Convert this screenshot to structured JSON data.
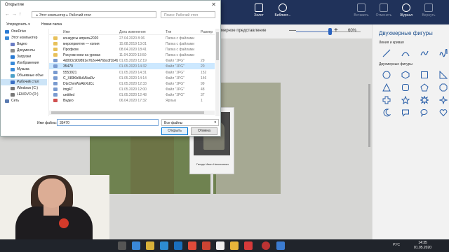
{
  "dialog": {
    "title": "Открытие",
    "close_glyph": "✕",
    "address": "▸ Этот компьютер ▸ Рабочий стол",
    "search_placeholder": "Поиск: Рабочий стол",
    "toolbar": {
      "organize": "Упорядочить ▾",
      "new_folder": "Новая папка"
    },
    "tree": [
      {
        "label": "OneDrive",
        "color": "#2b7bd3"
      },
      {
        "label": "Этот компьютер",
        "color": "#3a8ad8"
      },
      {
        "label": "Видео",
        "color": "#6a7cc4"
      },
      {
        "label": "Документы",
        "color": "#8d8d8d"
      },
      {
        "label": "Загрузки",
        "color": "#2b7bd3"
      },
      {
        "label": "Изображения",
        "color": "#3a8ad8"
      },
      {
        "label": "Музыка",
        "color": "#3a8ad8"
      },
      {
        "label": "Объемные объе",
        "color": "#4aa0c8"
      },
      {
        "label": "Рабочий стол",
        "color": "#3a6fc4",
        "selected": true
      },
      {
        "label": "Windows (C:)",
        "color": "#777777"
      },
      {
        "label": "LENOVO (D:)",
        "color": "#777777"
      },
      {
        "label": "Сеть",
        "color": "#5a7ab0"
      }
    ],
    "columns": {
      "name": "Имя",
      "date": "Дата изменения",
      "type": "Тип",
      "size": "Размер"
    },
    "files": [
      {
        "name": "конкурсы апрель2020",
        "date": "27.04.2020 8:36",
        "type": "Папка с файлами",
        "size": "",
        "color": "#e8c15a"
      },
      {
        "name": "мероприятия — копия",
        "date": "15.08.2019 13:01",
        "type": "Папка с файлами",
        "size": "",
        "color": "#e8c15a"
      },
      {
        "name": "Профком",
        "date": "08.04.2020 18:41",
        "type": "Папка с файлами",
        "size": "",
        "color": "#e8c15a"
      },
      {
        "name": "Рисунки мои на уроках",
        "date": "11.04.2020 13:50",
        "type": "Папка с файлами",
        "size": "",
        "color": "#e8c15a"
      },
      {
        "name": "4d093c909891e762e4476bcdf1b494b9",
        "date": "01.05.2020 12:19",
        "type": "Файл \"JPG\"",
        "size": "29",
        "color": "#7a9bd0"
      },
      {
        "name": "35470",
        "date": "01.05.2020 14:32",
        "type": "Файл \"JPG\"",
        "size": "20",
        "color": "#7a9bd0",
        "selected": true
      },
      {
        "name": "5553921",
        "date": "01.05.2020 14:31",
        "type": "Файл \"JPG\"",
        "size": "152",
        "color": "#7a9bd0"
      },
      {
        "name": "C_X83Kb9kAAkaRv",
        "date": "01.05.2020 14:14",
        "type": "Файл \"JPG\"",
        "size": "146",
        "color": "#7a9bd0"
      },
      {
        "name": "DtsChmWsAEXdCc",
        "date": "01.05.2020 12:33",
        "type": "Файл \"JPG\"",
        "size": "99",
        "color": "#7a9bd0"
      },
      {
        "name": "img47",
        "date": "01.05.2020 12:00",
        "type": "Файл \"JPG\"",
        "size": "48",
        "color": "#7a9bd0"
      },
      {
        "name": "untitled",
        "date": "01.05.2020 12:48",
        "type": "Файл \"JPG\"",
        "size": "37",
        "color": "#7a9bd0"
      },
      {
        "name": "Видео",
        "date": "06.04.2020 17:32",
        "type": "Ярлык",
        "size": "1",
        "color": "#d05050"
      }
    ],
    "filename_label": "Имя файла:",
    "filename_value": "35470",
    "filetype_value": "Все файлы",
    "open_label": "Открыть",
    "cancel_label": "Отмена"
  },
  "ribbon": {
    "canvas_label": "Холст",
    "library_label": "Библиот...",
    "paste_label": "Вставить",
    "undo_label": "Отменить",
    "history_label": "Журнал",
    "redo_label": "Вернуть"
  },
  "viewbar": {
    "mode_label": "змерное представление",
    "minus": "—",
    "plus": "+",
    "zoom": "60%"
  },
  "shapes_panel": {
    "title": "Двухмерные фигуры",
    "section1": "Линия и кривая",
    "section2": "Двухмерные фигуры"
  },
  "photo": {
    "placard_caption": "Гвоздь Иван Николаевич"
  },
  "taskbar": {
    "lang": "РУС",
    "time": "14:35",
    "date": "01.05.2020"
  }
}
